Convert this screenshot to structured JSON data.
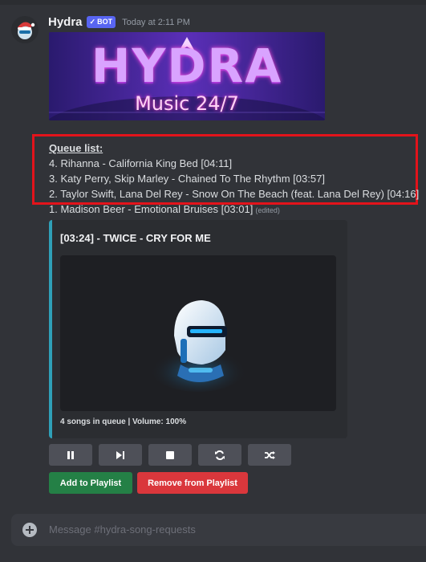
{
  "message": {
    "username": "Hydra",
    "bot_tag": "BOT",
    "timestamp": "Today at 2:11 PM",
    "banner": {
      "logo_text": "HYDRA",
      "subtitle": "Music 24/7"
    },
    "queue": {
      "title": "Queue list:",
      "items": [
        "4. Rihanna - California King Bed [04:11]",
        "3. Katy Perry, Skip Marley - Chained To The Rhythm [03:57]",
        "2. Taylor Swift, Lana Del Rey - Snow On The Beach (feat. Lana Del Rey) [04:16]",
        "1. Madison Beer - Emotional Bruises [03:01]"
      ],
      "edited_label": "(edited)"
    },
    "embed": {
      "title": "[03:24] - TWICE - CRY FOR ME",
      "footer": "4 songs in queue | Volume: 100%",
      "accent_color": "#2fa0b8"
    },
    "controls": [
      {
        "name": "pause",
        "icon": "pause-icon"
      },
      {
        "name": "skip",
        "icon": "skip-icon"
      },
      {
        "name": "stop",
        "icon": "stop-icon"
      },
      {
        "name": "loop",
        "icon": "repeat-icon"
      },
      {
        "name": "shuffle",
        "icon": "shuffle-icon"
      }
    ],
    "buttons": {
      "add_to_playlist": "Add to Playlist",
      "remove_from_playlist": "Remove from Playlist"
    }
  },
  "composer": {
    "placeholder": "Message #hydra-song-requests"
  },
  "colors": {
    "background": "#313338",
    "embed": "#2b2d31",
    "bot_tag": "#5865f2",
    "green_button": "#248046",
    "red_button": "#da373c",
    "highlight_box": "#e3131b"
  }
}
